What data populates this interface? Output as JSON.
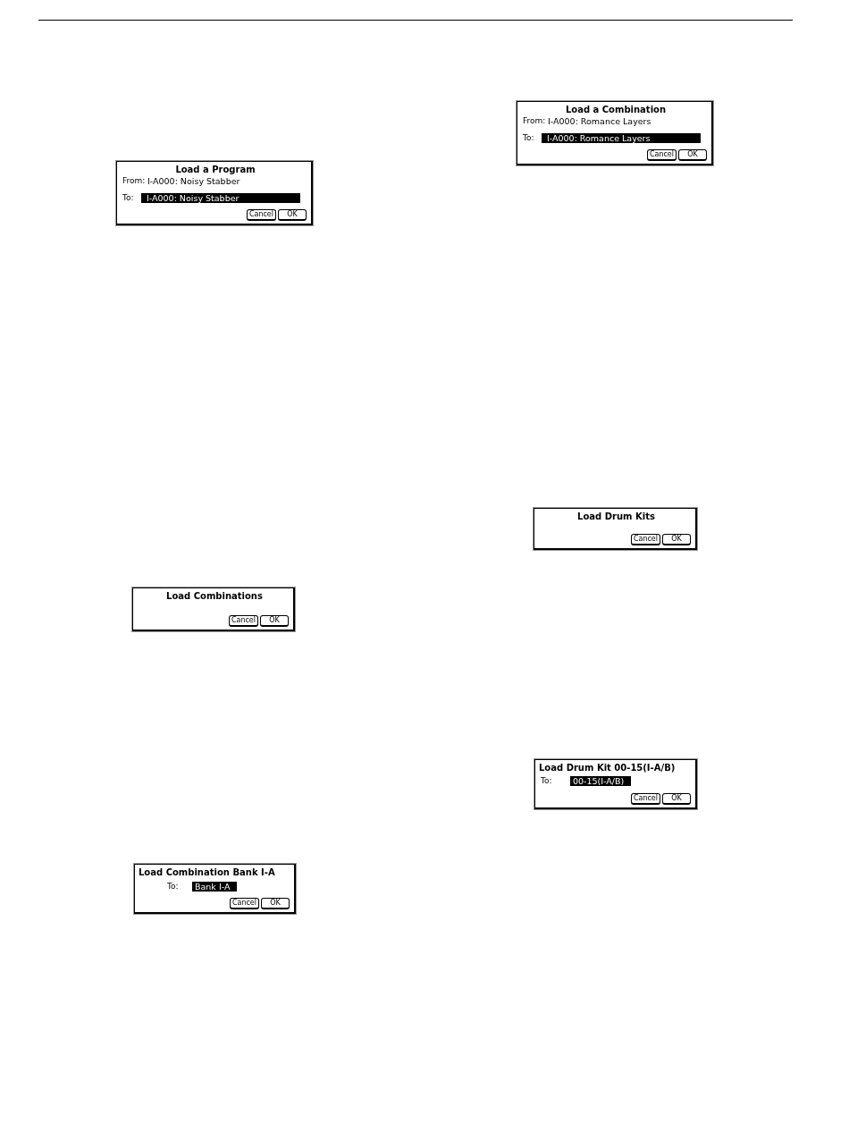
{
  "left_column": {
    "dialogs": [
      {
        "title": "Load a Program",
        "from": {
          "label": "From:",
          "value": "I-A000: Noisy Stabber"
        },
        "to": {
          "label": "To:",
          "value": "I-A000: Noisy Stabber"
        },
        "buttons": [
          "Cancel",
          "OK"
        ]
      },
      {
        "title": "Load Combinations",
        "buttons": [
          "Cancel",
          "OK"
        ]
      },
      {
        "title": "Load Combination Bank I-A",
        "to": {
          "label": "To:",
          "value": "Bank I-A"
        },
        "buttons": [
          "Cancel",
          "OK"
        ]
      }
    ]
  },
  "right_column": {
    "dialogs": [
      {
        "title": "Load a Combination",
        "from": {
          "label": "From:",
          "value": "I-A000: Romance Layers"
        },
        "to": {
          "label": "To:",
          "value": "I-A000: Romance Layers"
        },
        "buttons": [
          "Cancel",
          "OK"
        ]
      },
      {
        "title": "Load Drum Kits",
        "buttons": [
          "Cancel",
          "OK"
        ]
      },
      {
        "title": "Load Drum Kit 00-15(I-A/B)",
        "to": {
          "label": "To:",
          "value": "00-15(I-A/B)"
        },
        "buttons": [
          "Cancel",
          "OK"
        ]
      }
    ]
  }
}
